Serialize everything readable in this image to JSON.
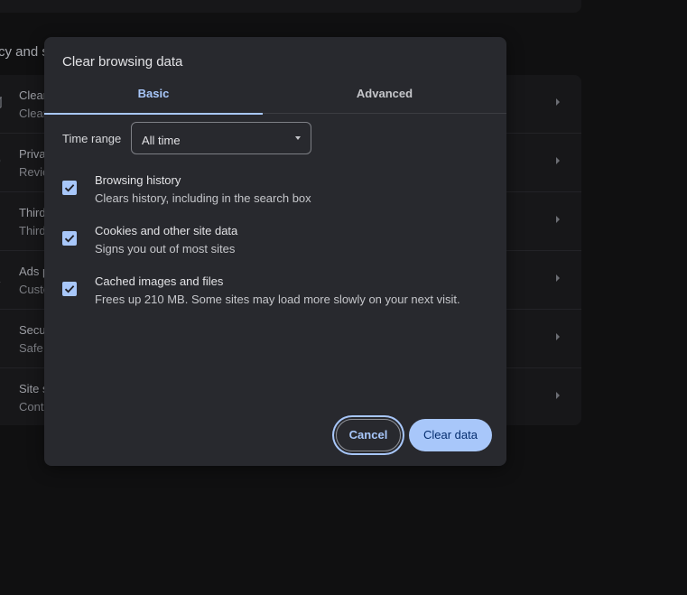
{
  "background": {
    "heading": "cy and s",
    "rows": [
      {
        "icon": "trash-icon",
        "title": "Clear",
        "subtitle": "Clear"
      },
      {
        "icon": "compass-icon",
        "title": "Priva",
        "subtitle": "Revie"
      },
      {
        "icon": "cookie-icon",
        "title": "Third",
        "subtitle": "Third"
      },
      {
        "icon": "ads-icon",
        "title": "Ads p",
        "subtitle": "Custo"
      },
      {
        "icon": "shield-icon",
        "title": "Secu",
        "subtitle": "Safe"
      },
      {
        "icon": "tune-icon",
        "title": "Site s",
        "subtitle": "Cont"
      }
    ]
  },
  "dialog": {
    "title": "Clear browsing data",
    "tabs": [
      {
        "label": "Basic",
        "selected": true
      },
      {
        "label": "Advanced",
        "selected": false
      }
    ],
    "time_range": {
      "label": "Time range",
      "value": "All time"
    },
    "options": [
      {
        "title": "Browsing history",
        "description": "Clears history, including in the search box",
        "checked": true
      },
      {
        "title": "Cookies and other site data",
        "description": "Signs you out of most sites",
        "checked": true
      },
      {
        "title": "Cached images and files",
        "description": "Frees up 210 MB. Some sites may load more slowly on your next visit.",
        "checked": true
      }
    ],
    "cancel_label": "Cancel",
    "clear_label": "Clear data"
  },
  "colors": {
    "accent": "#a8c7fa",
    "dialog_bg": "#28292e",
    "page_bg": "#101011"
  }
}
